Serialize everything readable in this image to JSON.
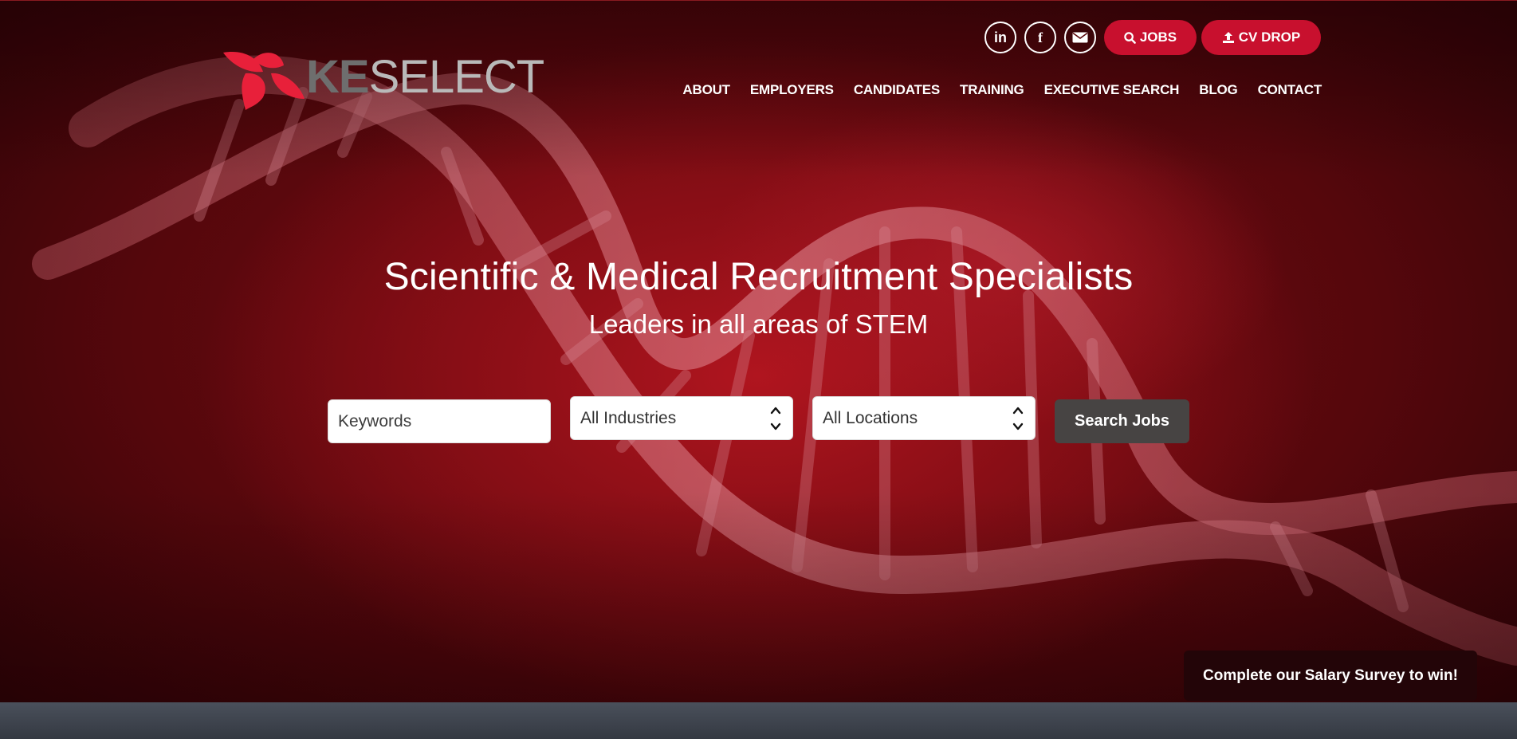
{
  "brand": {
    "name_part1": "KE",
    "name_part2": "SELECT",
    "logo_icon": "flower-petals-icon",
    "accent": "#c8102e"
  },
  "social": [
    {
      "name": "linkedin",
      "glyph": "in"
    },
    {
      "name": "facebook",
      "glyph": "f"
    },
    {
      "name": "email",
      "glyph": "envelope"
    }
  ],
  "top_buttons": {
    "jobs_label": "JOBS",
    "cv_label": "CV DROP"
  },
  "nav": {
    "items": [
      "ABOUT",
      "EMPLOYERS",
      "CANDIDATES",
      "TRAINING",
      "EXECUTIVE SEARCH",
      "BLOG",
      "CONTACT"
    ]
  },
  "hero": {
    "headline": "Scientific & Medical Recruitment Specialists",
    "subline": "Leaders in all areas of STEM",
    "background": "dna-helix-image"
  },
  "search": {
    "keywords_placeholder": "Keywords",
    "industries_selected": "All Industries",
    "locations_selected": "All Locations",
    "button_label": "Search Jobs"
  },
  "survey": {
    "label": "Complete our Salary Survey to win!"
  }
}
